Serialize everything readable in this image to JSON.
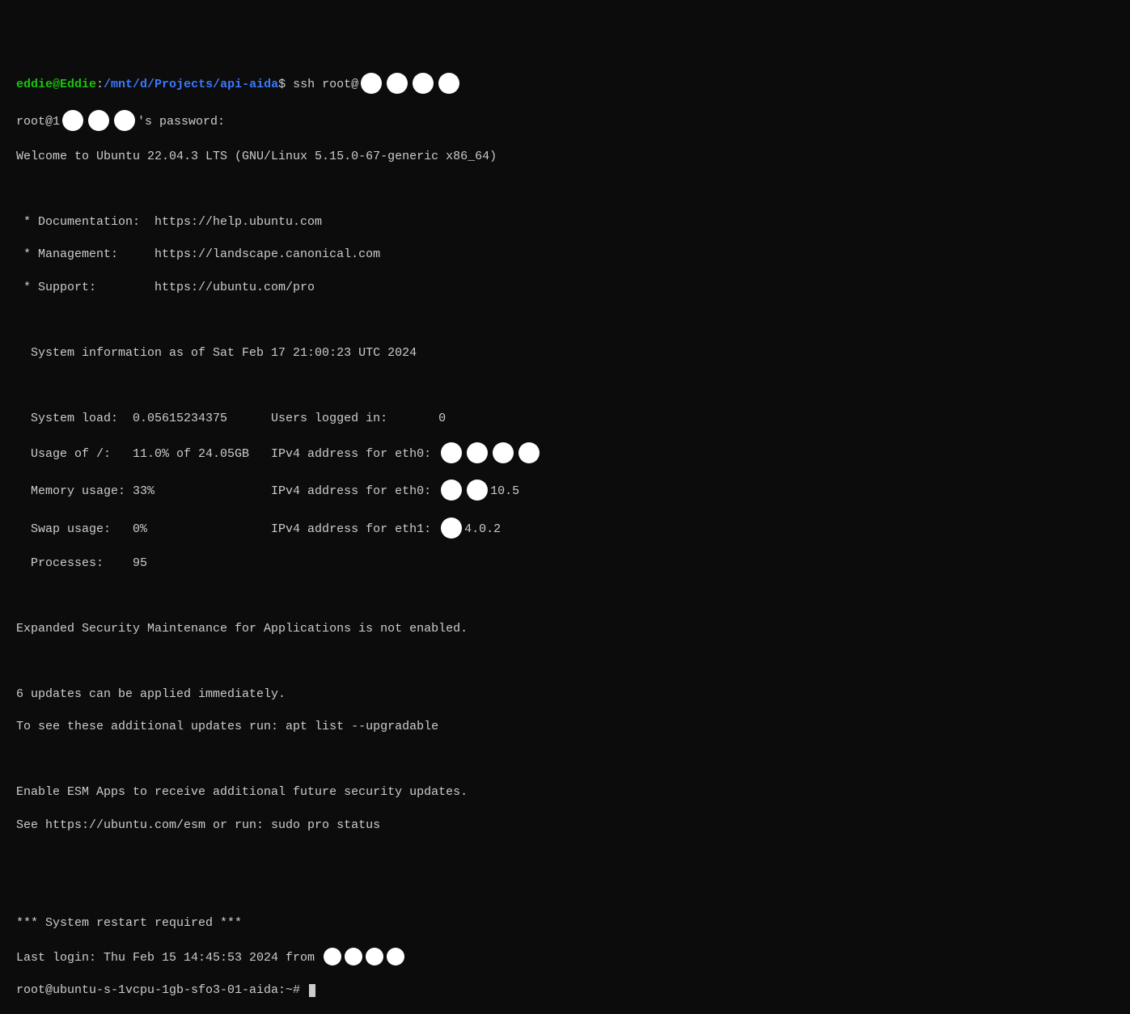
{
  "prompt": {
    "user": "eddie@Eddie",
    "sep": ":",
    "path": "/mnt/d/Projects/api-aida",
    "dollar": "$",
    "cmd": "ssh root@"
  },
  "pwline_prefix": "root@1",
  "pwline_suffix": "'s password:",
  "welcome": "Welcome to Ubuntu 22.04.3 LTS (GNU/Linux 5.15.0-67-generic x86_64)",
  "links": {
    "doc": " * Documentation:  https://help.ubuntu.com",
    "mgmt": " * Management:     https://landscape.canonical.com",
    "sup": " * Support:        https://ubuntu.com/pro"
  },
  "sysinfo_header": "  System information as of Sat Feb 17 21:00:23 UTC 2024",
  "sys": {
    "load": "  System load:  0.05615234375      Users logged in:       0",
    "usage_l": "  Usage of /:   11.0% of 24.05GB   IPv4 address for eth0: ",
    "mem_l": "  Memory usage: 33%                IPv4 address for eth0: ",
    "mem_r": "10.5",
    "swap_l": "  Swap usage:   0%                 IPv4 address for eth1: ",
    "swap_r": "4.0.2",
    "proc": "  Processes:    95"
  },
  "esm1": "Expanded Security Maintenance for Applications is not enabled.",
  "upd1": "6 updates can be applied immediately.",
  "upd2": "To see these additional updates run: apt list --upgradable",
  "esm2": "Enable ESM Apps to receive additional future security updates.",
  "esm3": "See https://ubuntu.com/esm or run: sudo pro status",
  "restart": "*** System restart required ***",
  "lastlogin": "Last login: Thu Feb 15 14:45:53 2024 from ",
  "shellprompt": "root@ubuntu-s-1vcpu-1gb-sfo3-01-aida:~# "
}
